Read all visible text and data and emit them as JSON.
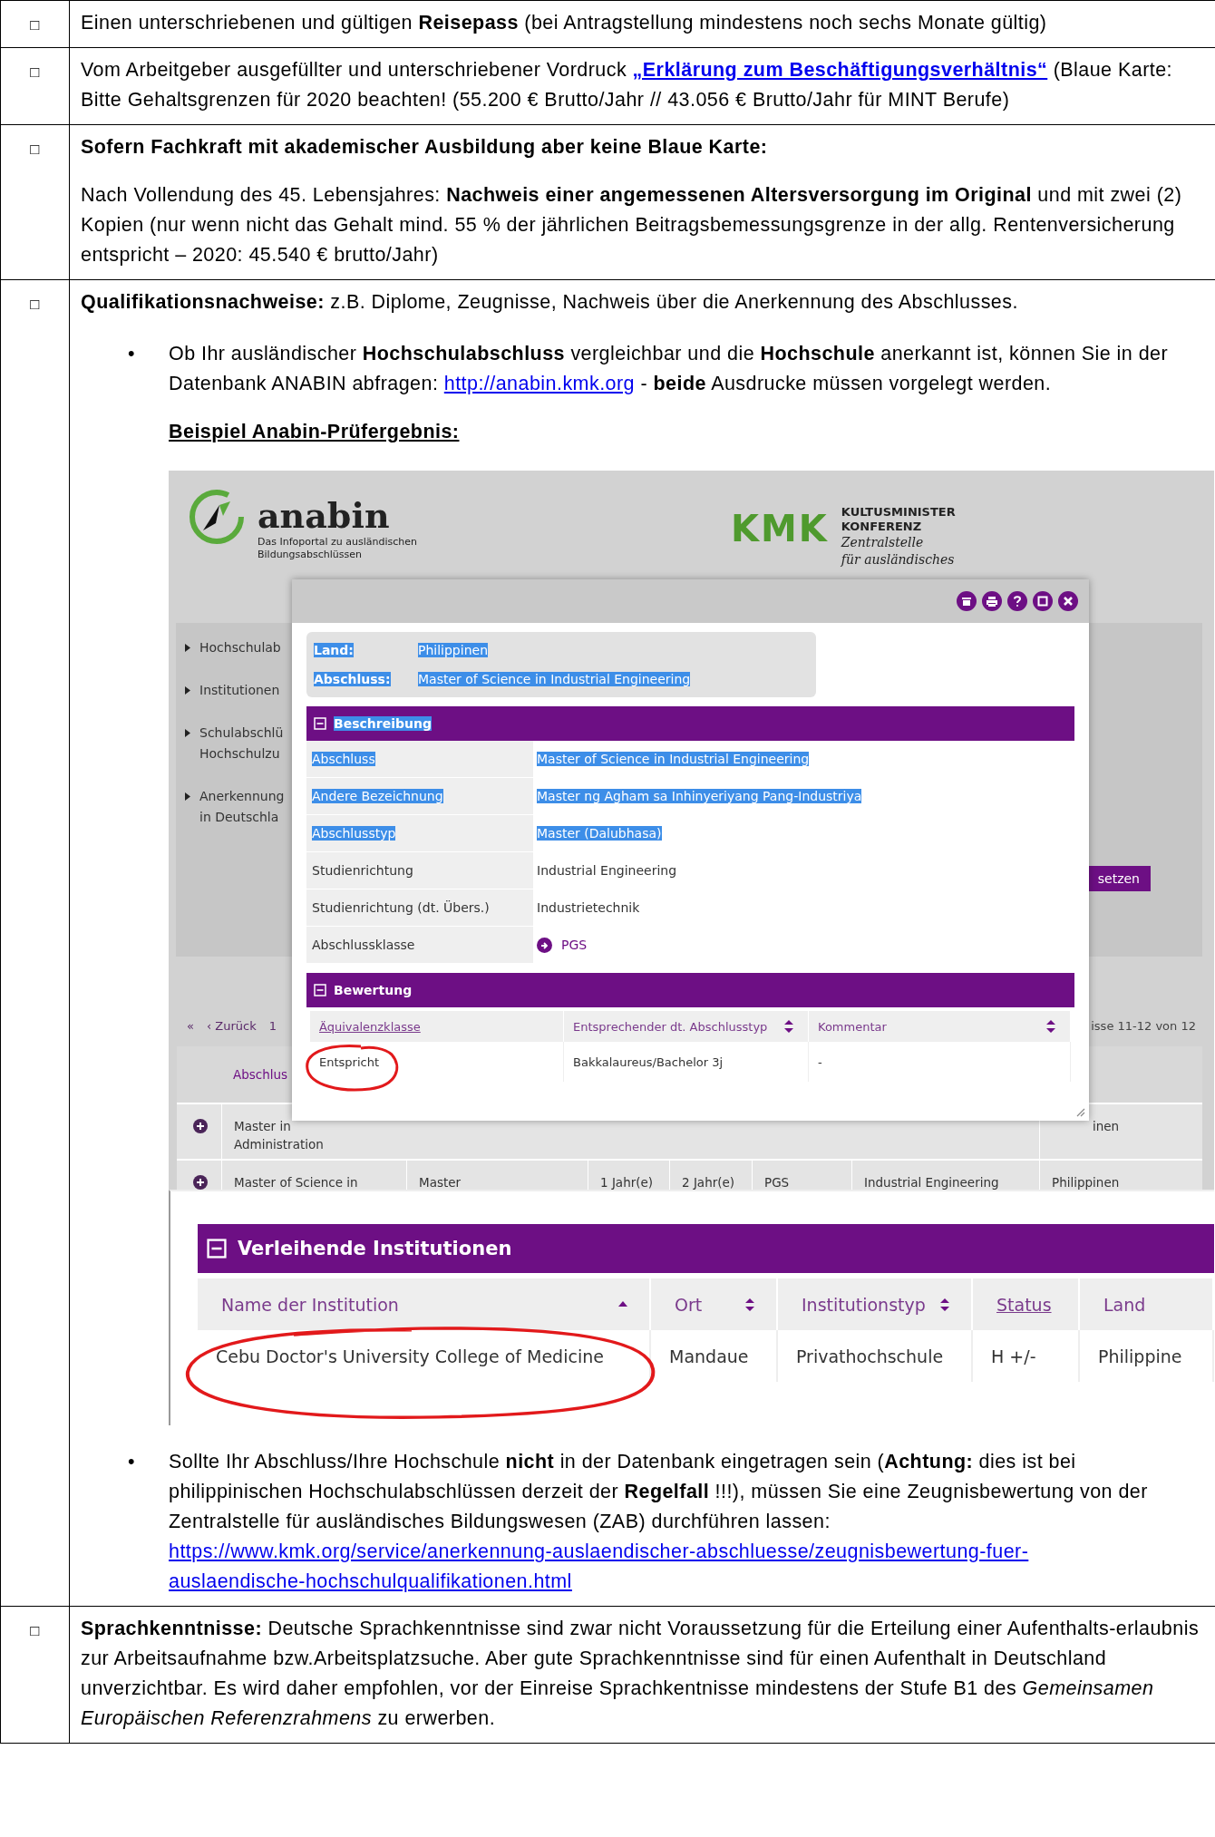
{
  "rows": [
    {
      "box": "□",
      "blocks": [
        {
          "kind": "para",
          "parts": [
            {
              "text": "Einen unterschriebenen und gültigen **Reisepass** (bei Antragstellung mindestens noch sechs Monate gültig)"
            }
          ]
        }
      ]
    },
    {
      "box": "□",
      "blocks": [
        {
          "kind": "para",
          "parts": [
            {
              "text": "Vom Arbeitgeber ausgefüllter und unterschriebener Vordruck "
            },
            {
              "link": "„Erklärung zum Beschäftigungsverhältnis“",
              "bold": true
            },
            {
              "text": " (Blaue Karte: Bitte Gehaltsgrenzen für 2020 beachten! (55.200 € Brutto/Jahr // 43.056 € Brutto/Jahr für MINT Berufe)"
            }
          ]
        }
      ]
    },
    {
      "box": "□",
      "blocks": [
        {
          "kind": "heading",
          "text": "Sofern Fachkraft mit akademischer Ausbildung aber keine Blaue Karte:"
        },
        {
          "kind": "para",
          "parts": [
            {
              "text": "Nach Vollendung des 45. Lebensjahres: **Nachweis einer angemessenen Altersversorgung im Original** und mit zwei (2) Kopien (nur wenn nicht das Gehalt mind. 55 % der jährlichen Beitragsbemessungsgrenze in der allg. Rentenversicherung entspricht – 2020: 45.540 € brutto/Jahr)"
            }
          ]
        }
      ]
    },
    {
      "box": "□",
      "blocks": [
        {
          "kind": "para",
          "parts": [
            {
              "text": "**Qualifikationsnachweise:** z.B. Diplome, Zeugnisse, Nachweis über die Anerkennung des Abschlusses."
            }
          ]
        },
        {
          "kind": "bullet",
          "bullet": "•",
          "blocks": [
            {
              "kind": "para",
              "parts": [
                {
                  "text": "Ob Ihr ausländischer **Hochschulabschluss** vergleichbar und die **Hochschule** anerkannt ist, können Sie in der Datenbank ANABIN abfragen: "
                },
                {
                  "link": "http://anabin.kmk.org",
                  "bold": false
                },
                {
                  "text": " - **beide** Ausdrucke müssen vorgelegt werden."
                }
              ]
            },
            {
              "kind": "subheading",
              "text": "Beispiel Anabin-Prüfergebnis:"
            },
            {
              "kind": "screenshot"
            }
          ]
        },
        {
          "kind": "bullet",
          "bullet": "•",
          "blocks": [
            {
              "kind": "para",
              "parts": [
                {
                  "text": "Sollte Ihr Abschluss/Ihre Hochschule **nicht** in der Datenbank eingetragen sein (**Achtung:** dies ist bei philippinischen Hochschulabschlüssen derzeit der **Regelfall** !!!), müssen Sie eine Zeugnisbewertung von der Zentralstelle für ausländisches Bildungswesen (ZAB) durchführen lassen:"
                }
              ]
            },
            {
              "kind": "url",
              "text": "https://www.kmk.org/service/anerkennung-auslaendischer-abschluesse/zeugnisbewertung-fuer-auslaendische-hochschulqualifikationen.html"
            }
          ]
        }
      ]
    },
    {
      "box": "□",
      "blocks": [
        {
          "kind": "para",
          "parts": [
            {
              "text": "**Sprachkenntnisse:** Deutsche Sprachkenntnisse sind zwar nicht Voraussetzung für die Erteilung einer Aufenthalts-erlaubnis zur Arbeitsaufnahme bzw.Arbeitsplatzsuche. Aber gute Sprachkenntnisse sind für einen Aufenthalt in Deutschland unverzichtbar. Es wird daher empfohlen, vor der Einreise Sprachkentnisse mindestens der Stufe B1 des *Gemeinsamen Europäischen Referenzrahmens* zu erwerben."
            }
          ]
        }
      ]
    }
  ],
  "anabin_screenshot": {
    "logo": {
      "name": "anabin",
      "tagline": [
        "Das Infoportal zu ausländischen",
        "Bildungsabschlüssen"
      ]
    },
    "kmk": {
      "mark": "KMK",
      "title": [
        "KULTUSMINISTER",
        "KONFERENZ"
      ],
      "sub": [
        "Zentralstelle",
        "für ausländisches"
      ]
    },
    "nav": [
      {
        "lines": [
          "Hochschulab"
        ]
      },
      {
        "lines": [
          "Institutionen"
        ]
      },
      {
        "lines": [
          "Schulabschlü",
          "Hochschulzu"
        ]
      },
      {
        "lines": [
          "Anerkennung",
          "in Deutschla"
        ]
      }
    ],
    "apply_button": "setzen",
    "pagination": {
      "first": "«",
      "prev": "‹ Zurück",
      "page": "1",
      "summary": "isse 11-12 von 12"
    },
    "results": {
      "header": "Abschlus",
      "rows": [
        {
          "cells": [
            "Master in\nAdministration",
            "",
            "",
            "",
            "",
            "",
            "inen"
          ]
        },
        {
          "cells": [
            "Master of Science in",
            "Master",
            "1 Jahr(e)",
            "2 Jahr(e)",
            "PGS",
            "Industrial Engineering",
            "Philippinen"
          ]
        }
      ]
    },
    "modal": {
      "info": [
        {
          "label": "Land:",
          "value": "Philippinen",
          "selected": true
        },
        {
          "label": "Abschluss:",
          "value": "Master of Science in Industrial Engineering",
          "selected": true
        }
      ],
      "description": {
        "title": "Beschreibung",
        "selected": true,
        "rows": [
          {
            "label": "Abschluss",
            "value": "Master of Science in Industrial Engineering",
            "selected": true,
            "kind": "text"
          },
          {
            "label": "Andere Bezeichnung",
            "value": "Master ng Agham sa Inhinyeriyang Pang-Industriya",
            "selected": true,
            "kind": "text"
          },
          {
            "label": "Abschlusstyp",
            "value": "Master (Dalubhasa)",
            "selected": true,
            "kind": "text"
          },
          {
            "label": "Studienrichtung",
            "value": "Industrial Engineering",
            "selected": false,
            "kind": "text"
          },
          {
            "label": "Studienrichtung (dt. Übers.)",
            "value": "Industrietechnik",
            "selected": false,
            "kind": "text"
          },
          {
            "label": "Abschlussklasse",
            "value": "PGS",
            "selected": false,
            "kind": "link"
          }
        ]
      },
      "rating": {
        "title": "Bewertung",
        "selected": false,
        "columns": [
          {
            "label": "Äquivalenzklasse",
            "kind": "link"
          },
          {
            "label": "Entsprechender dt. Abschlusstyp",
            "kind": "sortable"
          },
          {
            "label": "Kommentar",
            "kind": "sortable"
          }
        ],
        "rows": [
          {
            "cells": [
              "Entspricht",
              "Bakkalaureus/Bachelor 3j",
              "-"
            ]
          }
        ]
      }
    },
    "institutions": {
      "title": "Verleihende Institutionen",
      "columns": [
        {
          "label": "Name der Institution",
          "kind": "ascending"
        },
        {
          "label": "Ort",
          "kind": "sortable"
        },
        {
          "label": "Institutionstyp",
          "kind": "sortable"
        },
        {
          "label": "Status",
          "kind": "link"
        },
        {
          "label": "Land",
          "kind": "plain"
        }
      ],
      "rows": [
        {
          "cells": [
            "Cebu Doctor's University College of Medicine",
            "Mandaue",
            "Privathochschule",
            "H +/-",
            "Philippine"
          ]
        }
      ]
    }
  }
}
